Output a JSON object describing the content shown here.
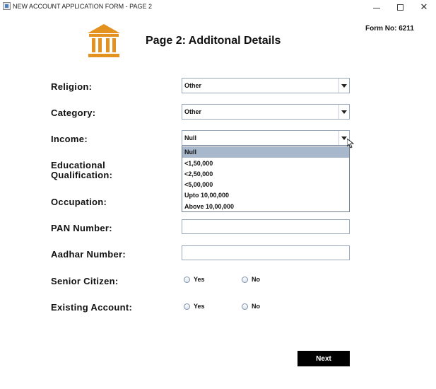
{
  "window": {
    "title": "NEW ACCOUNT APPLICATION FORM - PAGE 2",
    "minimize_glyph": "",
    "maximize_glyph": "",
    "close_glyph": "✕"
  },
  "header": {
    "form_no": "Form No: 6211",
    "page_title": "Page 2: Additonal Details",
    "logo_icon": "bank-building-icon",
    "logo_color": "#e3921f"
  },
  "fields": {
    "religion": {
      "label": "Religion:",
      "value": "Other"
    },
    "category": {
      "label": "Category:",
      "value": "Other"
    },
    "income": {
      "label": "Income:",
      "value": "Null",
      "options": [
        "Null",
        "<1,50,000",
        "<2,50,000",
        "<5,00,000",
        "Upto 10,00,000",
        "Above 10,00,000"
      ],
      "selected_index": 0
    },
    "education": {
      "label_line1": "Educational",
      "label_line2": "Qualification:"
    },
    "occupation": {
      "label": "Occupation:"
    },
    "pan": {
      "label": "PAN Number:",
      "value": ""
    },
    "aadhar": {
      "label": "Aadhar Number:",
      "value": ""
    },
    "senior_citizen": {
      "label": "Senior Citizen:",
      "yes": "Yes",
      "no": "No"
    },
    "existing_account": {
      "label": "Existing Account:",
      "yes": "Yes",
      "no": "No"
    }
  },
  "actions": {
    "next_label": "Next"
  }
}
